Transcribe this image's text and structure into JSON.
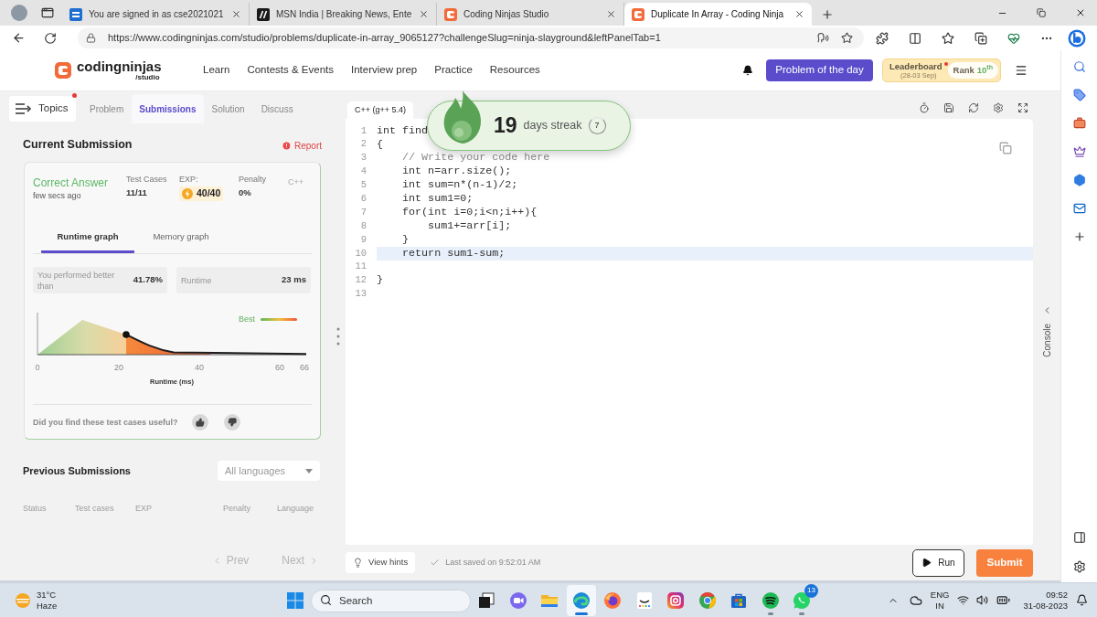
{
  "browser": {
    "tabs": [
      {
        "kind": "s",
        "title": "You are signed in as cse2021021",
        "selected": false
      },
      {
        "kind": "msn",
        "title": "MSN India | Breaking News, Ente",
        "selected": false
      },
      {
        "kind": "cn",
        "title": "Coding Ninjas Studio",
        "selected": false
      },
      {
        "kind": "cn",
        "title": "Duplicate In Array - Coding Ninja",
        "selected": true
      }
    ],
    "address": "https://www.codingninjas.com/studio/problems/duplicate-in-array_9065127?challengeSlug=ninja-slayground&leftPanelTab=1"
  },
  "header": {
    "logo": "codingninjas",
    "logo_sub": "/studio",
    "nav": [
      "Learn",
      "Contests & Events",
      "Interview prep",
      "Practice",
      "Resources"
    ],
    "problem_of_the_day": "Problem of the day",
    "leaderboard": {
      "label": "Leaderboard",
      "new": true,
      "period": "(28-03 Sep)",
      "rank_label": "Rank",
      "rank": "10$^{th}$"
    }
  },
  "left_panel": {
    "topics": {
      "label": "Topics",
      "notification": true
    },
    "tabs": [
      {
        "label": "Problem",
        "selected": false
      },
      {
        "label": "Submissions",
        "selected": true
      },
      {
        "label": "Solution",
        "selected": false
      },
      {
        "label": "Discuss",
        "selected": false
      }
    ],
    "current_submission": {
      "title": "Current Submission",
      "report": "Report",
      "status": "Correct Answer",
      "time": "few secs ago",
      "stats": [
        {
          "kind": "plain",
          "label": "Test Cases",
          "value": "11/11"
        },
        {
          "kind": "exp",
          "label": "EXP:",
          "value": "40/40"
        },
        {
          "kind": "plain",
          "label": "Penalty",
          "value": "0%"
        }
      ],
      "language": "C++",
      "graph_tabs": [
        {
          "label": "Runtime graph",
          "selected": true
        },
        {
          "label": "Memory graph",
          "selected": false
        }
      ],
      "metrics": [
        {
          "label": "You performed better than",
          "value": "41.78%"
        },
        {
          "label": "Runtime",
          "value": "23 ms"
        }
      ],
      "graph": {
        "legend": "Best",
        "x_tick_labels": [
          "0",
          "20",
          "40",
          "60",
          "66"
        ],
        "xlabel": "Runtime (ms)"
      },
      "feedback": "Did you find these test cases useful?"
    },
    "previous_submissions": {
      "title": "Previous Submissions",
      "filter": "All languages",
      "columns": [
        "Status",
        "Test cases",
        "EXP",
        "Penalty",
        "Language"
      ],
      "pager": [
        {
          "kind": "prev",
          "label": "Prev",
          "disabled": true
        },
        {
          "kind": "next",
          "label": "Next",
          "disabled": true
        }
      ]
    }
  },
  "editor": {
    "language": "C++ (g++ 5.4)",
    "lines": [
      {
        "number": "1",
        "kind": "code",
        "code": "int find",
        "highlighted": false
      },
      {
        "number": "2",
        "kind": "code",
        "code": "{",
        "highlighted": false
      },
      {
        "number": "3",
        "kind": "comment",
        "code": "    // Write your code here",
        "highlighted": false
      },
      {
        "number": "4",
        "kind": "code",
        "code": "    int n=arr.size();",
        "highlighted": false
      },
      {
        "number": "5",
        "kind": "code",
        "code": "    int sum=n*(n-1)/2;",
        "highlighted": false
      },
      {
        "number": "6",
        "kind": "code",
        "code": "    int sum1=0;",
        "highlighted": false
      },
      {
        "number": "7",
        "kind": "code",
        "code": "    for(int i=0;i<n;i++){",
        "highlighted": false
      },
      {
        "number": "8",
        "kind": "code",
        "code": "        sum1+=arr[i];",
        "highlighted": false
      },
      {
        "number": "9",
        "kind": "code",
        "code": "    }",
        "highlighted": false
      },
      {
        "number": "10",
        "kind": "code",
        "code": "    return sum1-sum;",
        "highlighted": true
      },
      {
        "number": "11",
        "highlighted": false
      },
      {
        "number": "12",
        "kind": "code",
        "code": "}",
        "highlighted": false
      },
      {
        "number": "13",
        "highlighted": false
      }
    ],
    "streak": {
      "count": "19",
      "label": "days streak",
      "badge": "7"
    },
    "hint": "View hints",
    "saved": "Last saved on 9:52:01 AM",
    "run": "Run",
    "submit": "Submit"
  },
  "console": {
    "label": "Console"
  },
  "taskbar": {
    "weather": {
      "temperature": "31°C",
      "condition": "Haze"
    },
    "search": {
      "placeholder": "Search"
    },
    "apps": [
      {
        "kind": "taskview",
        "selected": false,
        "running": false
      },
      {
        "kind": "meet",
        "selected": false,
        "running": false
      },
      {
        "kind": "files",
        "selected": false,
        "running": false
      },
      {
        "kind": "edge",
        "selected": true,
        "running": true
      },
      {
        "kind": "firefox",
        "selected": false,
        "running": false
      },
      {
        "kind": "amazon",
        "selected": false,
        "running": false
      },
      {
        "kind": "instagram",
        "selected": false,
        "running": false
      },
      {
        "kind": "chrome",
        "selected": false,
        "running": false
      },
      {
        "kind": "store",
        "selected": false,
        "running": false
      },
      {
        "kind": "spotify",
        "selected": false,
        "running": true
      },
      {
        "kind": "whatsapp",
        "selected": false,
        "running": true,
        "badge": "13"
      }
    ],
    "tray": {
      "language": "ENG",
      "region": "IN",
      "time": "09:52",
      "date": "31-08-2023"
    }
  }
}
